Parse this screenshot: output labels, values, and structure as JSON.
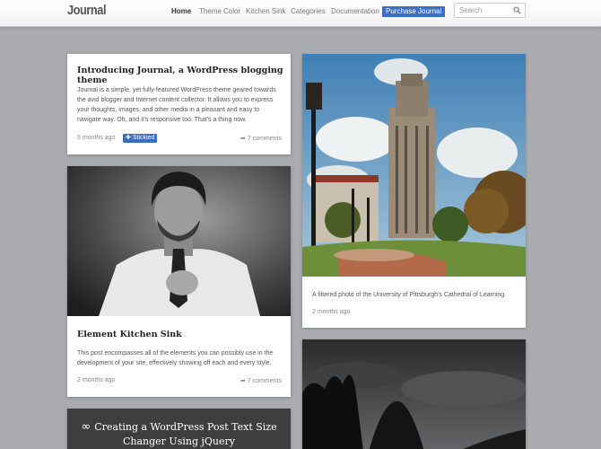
{
  "header": {
    "logo": "Journal",
    "nav": [
      {
        "label": "Home",
        "active": true
      },
      {
        "label": "Theme Color"
      },
      {
        "label": "Kitchen Sink"
      },
      {
        "label": "Categories"
      },
      {
        "label": "Documentation"
      },
      {
        "label": "Purchase Journal",
        "cta": true
      }
    ],
    "search_placeholder": "Search"
  },
  "posts": {
    "intro": {
      "title": "Introducing Journal, a WordPress blogging theme",
      "excerpt": "Journal is a simple, yet fully-featured WordPress theme geared towards the avid blogger and Internet content collector. It allows you to express your thoughts, images, and other media in a pleasant and easy to navigate way. Oh, and it's responsive too. That's a thing now.",
      "age": "5 months ago",
      "sticky": "Stickied",
      "comments": "7 comments"
    },
    "kitchen": {
      "title": "Element Kitchen Sink",
      "excerpt": "This post encompasses all of the elements you can possibly use in the development of your site, effectively showing off each and every style.",
      "age": "2 months ago",
      "comments": "7 comments"
    },
    "photo": {
      "caption": "A filtered photo of the University of Pittsburgh's Cathedral of Learning.",
      "age": "2 months ago"
    },
    "link": {
      "title": "Creating a WordPress Post Text Size Changer Using jQuery",
      "icon": "infinity-link-icon"
    }
  },
  "colors": {
    "accent": "#3b6fc4",
    "background": "#a9abae"
  }
}
